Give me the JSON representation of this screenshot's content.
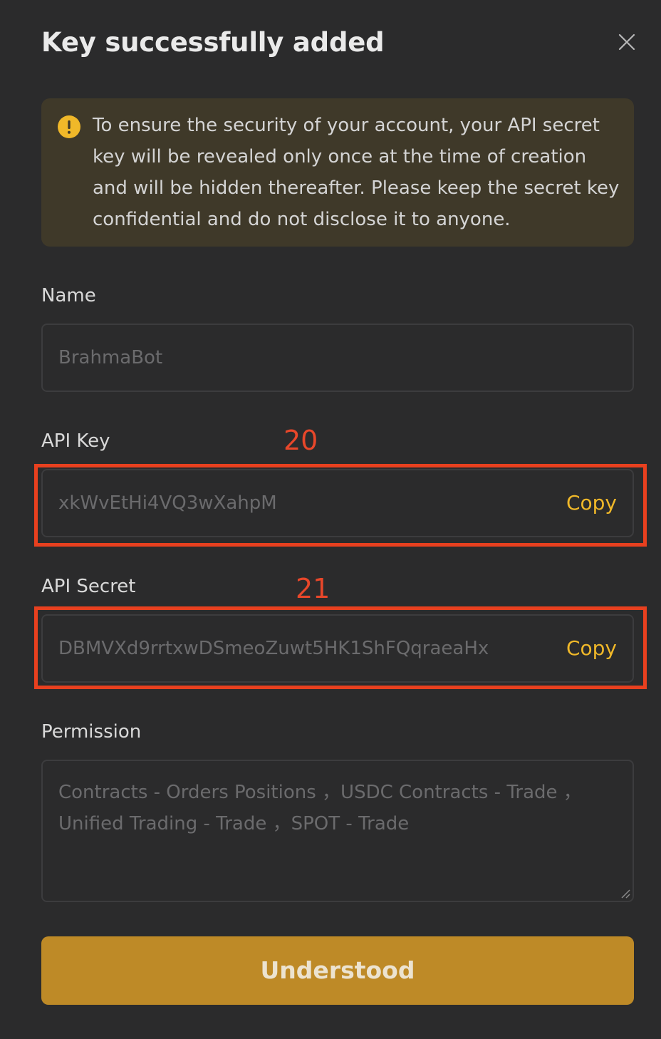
{
  "dialog": {
    "title": "Key successfully added",
    "notice": "To ensure the security of your account, your API secret key will be revealed only once at the time of creation and will be hidden thereafter. Please keep the secret key confidential and do not disclose it to anyone.",
    "name": {
      "label": "Name",
      "value": "BrahmaBot"
    },
    "api_key": {
      "label": "API Key",
      "value": "xkWvEtHi4VQ3wXahpM",
      "copy_label": "Copy"
    },
    "api_secret": {
      "label": "API Secret",
      "value": "DBMVXd9rrtxwDSmeoZuwt5HK1ShFQqraeaHx",
      "copy_label": "Copy"
    },
    "permission": {
      "label": "Permission",
      "value": "Contracts - Orders Positions ，USDC Contracts - Trade ，Unified Trading - Trade ，SPOT - Trade"
    },
    "confirm_label": "Understood"
  },
  "annotations": {
    "api_key_marker": "20",
    "api_secret_marker": "21"
  },
  "icons": {
    "close": "close-icon",
    "warning": "warning-icon"
  },
  "colors": {
    "background": "#2b2b2c",
    "accent": "#f0b829",
    "button": "#be8a27",
    "annotation": "#e8401f",
    "notice_bg": "#3f3929"
  }
}
